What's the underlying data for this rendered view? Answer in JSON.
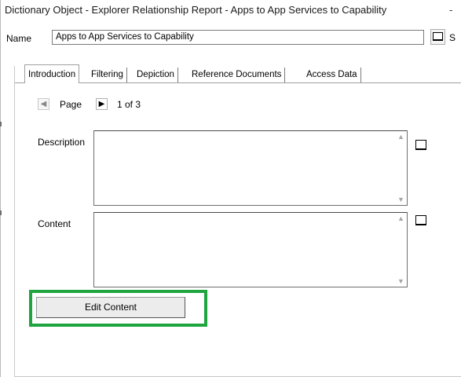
{
  "window": {
    "title": "Dictionary Object - Explorer Relationship Report - Apps to App Services to Capability",
    "title_trail": "-"
  },
  "name_field": {
    "label": "Name",
    "value": "Apps to App Services to Capability",
    "trailing_label_cut": "S"
  },
  "tabs": [
    {
      "label": "Introduction",
      "active": true
    },
    {
      "label": "Filtering",
      "active": false
    },
    {
      "label": "Depiction",
      "active": false
    },
    {
      "label": "Reference Documents",
      "active": false
    },
    {
      "label": "Access Data",
      "active": false
    }
  ],
  "pager": {
    "label": "Page",
    "prev_glyph": "◀",
    "next_glyph": "▶",
    "count": "1 of 3"
  },
  "description": {
    "label": "Description",
    "value": ""
  },
  "content": {
    "label": "Content",
    "value": ""
  },
  "edit_button": {
    "label": "Edit Content"
  },
  "colors": {
    "highlight": "#1fa53f"
  }
}
